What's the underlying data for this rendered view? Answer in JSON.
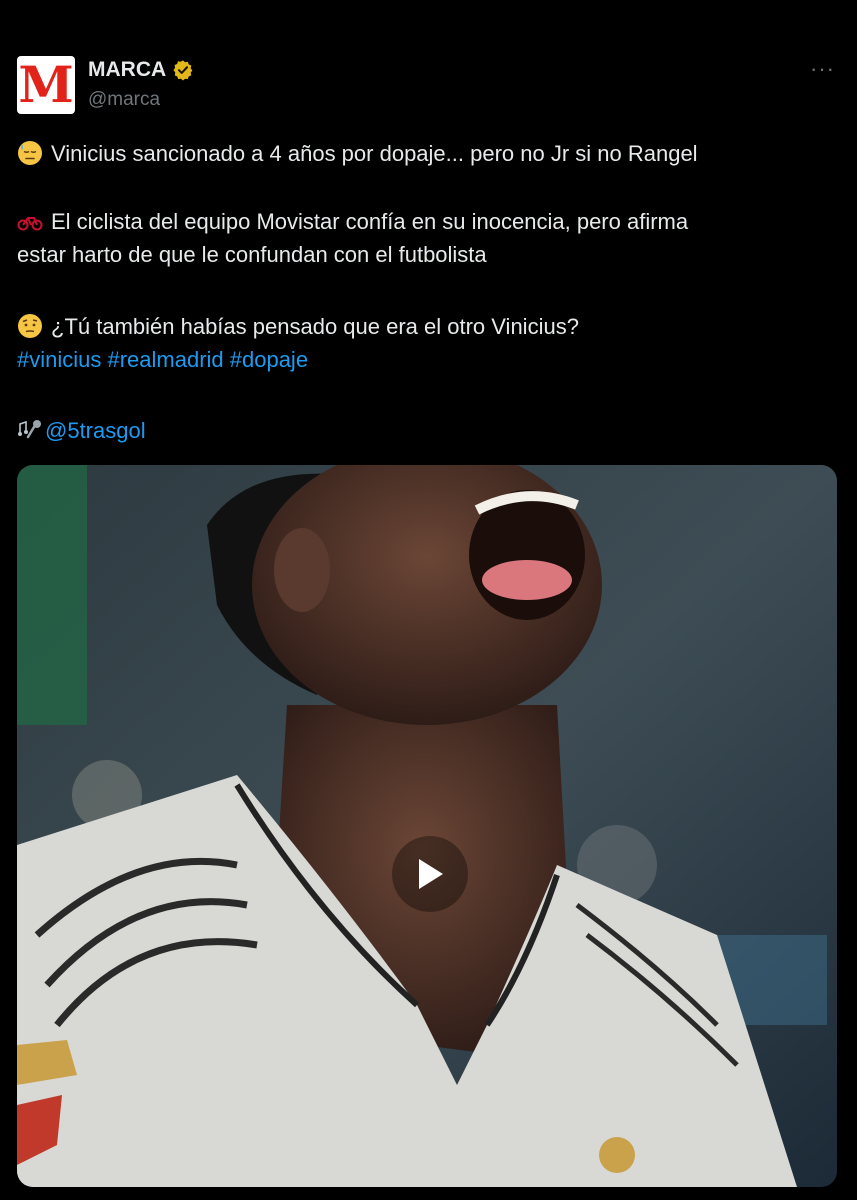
{
  "account": {
    "name": "MARCA",
    "handle": "@marca",
    "avatar_letter": "M",
    "verified": "verified-gold-badge",
    "more_label": "···"
  },
  "tweet": {
    "line1": "Vinicius sancionado a 4 años por dopaje... pero no Jr si no Rangel",
    "line2a": "El ciclista del equipo Movistar confía en su inocencia, pero afirma",
    "line2b": "estar harto de que le confundan con el futbolista",
    "line3": "¿Tú también habías pensado que era el otro Vinicius?",
    "hashtags": "#vinicius #realmadrid #dopaje",
    "credit": "@5trasgol"
  },
  "icons": {
    "line1": "downcast-sweat-face-emoji",
    "line2": "bicycle-emoji",
    "line3": "raised-eyebrow-face-emoji",
    "credit": "music-microphone-emoji",
    "media": "play-icon"
  },
  "colors": {
    "background": "#000000",
    "text": "#e7e9ea",
    "secondary": "#71767b",
    "link": "#1d9bf0",
    "brand_red": "#e2231a",
    "verified_gold": "#e2b719"
  }
}
